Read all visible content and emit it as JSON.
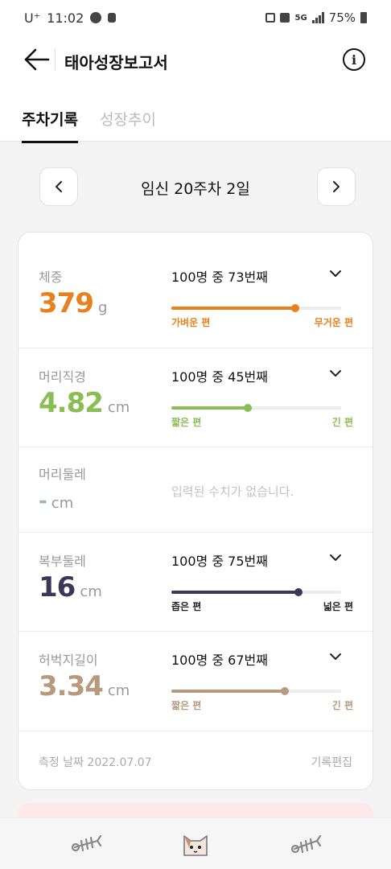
{
  "status_bar": {
    "carrier": "U⁺",
    "time": "11:02",
    "network": "5G",
    "battery": "75%"
  },
  "app_bar": {
    "title": "태아성장보고서",
    "info_label": "i"
  },
  "tabs": [
    {
      "label": "주차기록",
      "active": true
    },
    {
      "label": "성장추이",
      "active": false
    }
  ],
  "week_nav": {
    "label": "임신 20주차 2일"
  },
  "measurements": [
    {
      "name": "체중",
      "value": "379",
      "unit": "g",
      "rank": "100명 중 73번째",
      "percentile": 0.73,
      "low_label": "가벼운 편",
      "high_label": "무거운 편",
      "color": "#e8801e"
    },
    {
      "name": "머리직경",
      "value": "4.82",
      "unit": "cm",
      "rank": "100명 중 45번째",
      "percentile": 0.45,
      "low_label": "짧은 편",
      "high_label": "긴 편",
      "color": "#8bbd55"
    },
    {
      "name": "머리둘레",
      "value": "-",
      "unit": "cm",
      "empty_message": "입력된 수치가 없습니다.",
      "color": "#9ab4c6"
    },
    {
      "name": "복부둘레",
      "value": "16",
      "unit": "cm",
      "rank": "100명 중 75번째",
      "percentile": 0.75,
      "low_label": "좁은 편",
      "high_label": "넓은 편",
      "color": "#3a3759"
    },
    {
      "name": "허벅지길이",
      "value": "3.34",
      "unit": "cm",
      "rank": "100명 중 67번째",
      "percentile": 0.67,
      "low_label": "짧은 편",
      "high_label": "긴 편",
      "color": "#b79a7e"
    }
  ],
  "footer": {
    "date_label": "측정 날짜 2022.07.07",
    "edit_label": "기록편집"
  },
  "bottom_nav": [
    {
      "icon": "fish-bone-icon"
    },
    {
      "icon": "cat-face-icon"
    },
    {
      "icon": "fish-bone-icon"
    }
  ]
}
